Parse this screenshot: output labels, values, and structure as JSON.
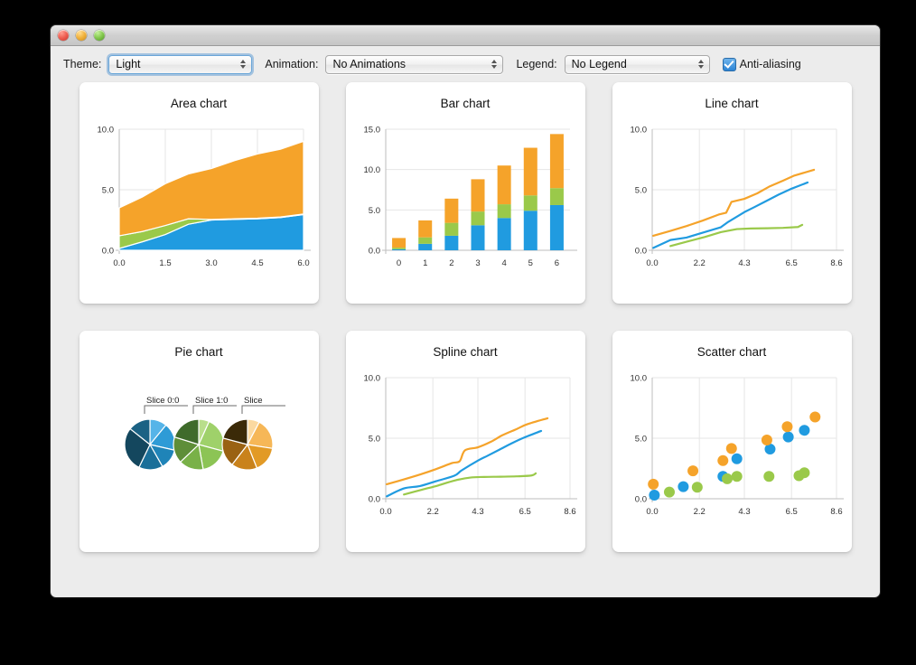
{
  "window": {
    "title": "",
    "controls": [
      "close-button",
      "minimize-button",
      "zoom-button"
    ]
  },
  "toolbar": {
    "theme_label": "Theme:",
    "theme_value": "Light",
    "animation_label": "Animation:",
    "animation_value": "No Animations",
    "legend_label": "Legend:",
    "legend_value": "No Legend",
    "antialiasing_label": "Anti-aliasing",
    "antialiasing_checked": true
  },
  "colors": {
    "series_blue": "#209be0",
    "series_green": "#9ac94a",
    "series_orange": "#f5a32a",
    "background": "#ececec",
    "card": "#ffffff",
    "grid": "#e6e6e6",
    "axis_text": "#303030",
    "accent": "#2b84d6"
  },
  "chart_data": [
    {
      "type": "area",
      "title": "Area chart",
      "xlabel": "",
      "ylabel": "",
      "xlim": [
        0.0,
        6.0
      ],
      "ylim": [
        0.0,
        10.0
      ],
      "xticks": [
        "0.0",
        "1.5",
        "3.0",
        "4.5",
        "6.0"
      ],
      "xtick_values": [
        0.0,
        1.5,
        3.0,
        4.5,
        6.0
      ],
      "yticks": [
        "0.0",
        "5.0",
        "10.0"
      ],
      "ytick_values": [
        0.0,
        5.0,
        10.0
      ],
      "grid": true,
      "legend": "none",
      "stacked": true,
      "x": [
        0.0,
        0.75,
        1.5,
        2.25,
        3.0,
        3.75,
        4.5,
        5.25,
        6.0
      ],
      "series": [
        {
          "name": "series-blue",
          "color": "#209be0",
          "values": [
            0.15,
            0.7,
            1.3,
            2.15,
            2.5,
            2.55,
            2.6,
            2.7,
            2.95
          ]
        },
        {
          "name": "series-green",
          "color": "#9ac94a",
          "values": [
            1.05,
            0.85,
            0.75,
            0.45,
            0.05,
            0.05,
            0.05,
            0.05,
            0.05
          ]
        },
        {
          "name": "series-orange",
          "color": "#f5a32a",
          "values": [
            2.3,
            2.85,
            3.45,
            3.7,
            4.2,
            4.8,
            5.3,
            5.6,
            6.0
          ]
        }
      ]
    },
    {
      "type": "bar",
      "title": "Bar chart",
      "xlabel": "",
      "ylabel": "",
      "ylim": [
        0.0,
        15.0
      ],
      "categories": [
        "0",
        "1",
        "2",
        "3",
        "4",
        "5",
        "6"
      ],
      "yticks": [
        "0.0",
        "5.0",
        "10.0",
        "15.0"
      ],
      "ytick_values": [
        0.0,
        5.0,
        10.0,
        15.0
      ],
      "grid": true,
      "legend": "none",
      "stacked": true,
      "series": [
        {
          "name": "series-blue",
          "color": "#209be0",
          "values": [
            0.12,
            0.8,
            1.8,
            3.1,
            4.0,
            4.9,
            5.6
          ]
        },
        {
          "name": "series-green",
          "color": "#9ac94a",
          "values": [
            0.2,
            0.8,
            1.6,
            1.7,
            1.7,
            1.9,
            2.1
          ]
        },
        {
          "name": "series-orange",
          "color": "#f5a32a",
          "values": [
            1.2,
            2.1,
            3.0,
            4.0,
            4.8,
            5.9,
            6.7
          ]
        }
      ]
    },
    {
      "type": "line",
      "title": "Line chart",
      "xlabel": "",
      "ylabel": "",
      "xlim": [
        0.0,
        8.6
      ],
      "ylim": [
        0.0,
        10.0
      ],
      "xticks": [
        "0.0",
        "2.2",
        "4.3",
        "6.5",
        "8.6"
      ],
      "xtick_values": [
        0.0,
        2.2,
        4.3,
        6.5,
        8.6
      ],
      "yticks": [
        "0.0",
        "5.0",
        "10.0"
      ],
      "ytick_values": [
        0.0,
        5.0,
        10.0
      ],
      "grid": true,
      "legend": "none",
      "smooth": false,
      "series": [
        {
          "name": "series-blue",
          "color": "#209be0",
          "points": [
            [
              0.05,
              0.2
            ],
            [
              0.85,
              0.85
            ],
            [
              1.6,
              1.05
            ],
            [
              2.35,
              1.45
            ],
            [
              3.2,
              1.9
            ],
            [
              3.55,
              2.35
            ],
            [
              4.3,
              3.15
            ],
            [
              4.75,
              3.55
            ],
            [
              5.3,
              4.05
            ],
            [
              5.9,
              4.6
            ],
            [
              6.45,
              5.05
            ],
            [
              7.25,
              5.6
            ]
          ]
        },
        {
          "name": "series-green",
          "color": "#9ac94a",
          "points": [
            [
              0.85,
              0.35
            ],
            [
              1.7,
              0.75
            ],
            [
              2.45,
              1.1
            ],
            [
              3.2,
              1.5
            ],
            [
              3.95,
              1.75
            ],
            [
              4.6,
              1.8
            ],
            [
              5.35,
              1.82
            ],
            [
              6.1,
              1.85
            ],
            [
              6.8,
              1.92
            ],
            [
              7.0,
              2.1
            ]
          ]
        },
        {
          "name": "series-orange",
          "color": "#f5a32a",
          "points": [
            [
              0.05,
              1.2
            ],
            [
              0.85,
              1.6
            ],
            [
              1.6,
              2.0
            ],
            [
              2.35,
              2.45
            ],
            [
              3.1,
              2.95
            ],
            [
              3.45,
              3.1
            ],
            [
              3.7,
              4.0
            ],
            [
              4.3,
              4.25
            ],
            [
              4.9,
              4.7
            ],
            [
              5.45,
              5.25
            ],
            [
              6.1,
              5.75
            ],
            [
              6.6,
              6.15
            ],
            [
              7.55,
              6.65
            ]
          ]
        }
      ]
    },
    {
      "type": "pie",
      "title": "Pie chart",
      "legend": "none",
      "annotations": [
        "Slice 0:0",
        "Slice 1:0",
        "Slice"
      ],
      "pies": [
        {
          "name": "pie-blue",
          "label": "Slice 0:0",
          "slices": [
            1,
            1.6,
            1.2,
            1.4,
            2.6,
            1.3
          ],
          "colors": [
            "#56b4e8",
            "#2e9bd6",
            "#1f84b8",
            "#1a6f99",
            "#14475e",
            "#1b6284"
          ]
        },
        {
          "name": "pie-green",
          "label": "Slice 1:0",
          "slices": [
            0.6,
            2.0,
            1.6,
            1.4,
            1.5,
            1.8
          ],
          "colors": [
            "#b9de8b",
            "#9fd16a",
            "#8cc455",
            "#79b148",
            "#5e8e38",
            "#3f6b2b"
          ]
        },
        {
          "name": "pie-orange",
          "label": "Slice",
          "slices": [
            0.7,
            1.8,
            1.5,
            1.5,
            1.7,
            1.9
          ],
          "colors": [
            "#fbd9a0",
            "#f6b757",
            "#e29a26",
            "#c9821b",
            "#9a6213",
            "#3b2a08"
          ]
        }
      ]
    },
    {
      "type": "spline",
      "title": "Spline chart",
      "xlabel": "",
      "ylabel": "",
      "xlim": [
        0.0,
        8.6
      ],
      "ylim": [
        0.0,
        10.0
      ],
      "xticks": [
        "0.0",
        "2.2",
        "4.3",
        "6.5",
        "8.6"
      ],
      "xtick_values": [
        0.0,
        2.2,
        4.3,
        6.5,
        8.6
      ],
      "yticks": [
        "0.0",
        "5.0",
        "10.0"
      ],
      "ytick_values": [
        0.0,
        5.0,
        10.0
      ],
      "grid": true,
      "legend": "none",
      "smooth": true,
      "series": [
        {
          "name": "series-blue",
          "color": "#209be0",
          "points": [
            [
              0.05,
              0.2
            ],
            [
              0.85,
              0.85
            ],
            [
              1.6,
              1.05
            ],
            [
              2.35,
              1.45
            ],
            [
              3.2,
              1.9
            ],
            [
              3.55,
              2.35
            ],
            [
              4.3,
              3.15
            ],
            [
              4.75,
              3.55
            ],
            [
              5.3,
              4.05
            ],
            [
              5.9,
              4.6
            ],
            [
              6.45,
              5.05
            ],
            [
              7.25,
              5.6
            ]
          ]
        },
        {
          "name": "series-green",
          "color": "#9ac94a",
          "points": [
            [
              0.85,
              0.35
            ],
            [
              1.7,
              0.75
            ],
            [
              2.45,
              1.1
            ],
            [
              3.2,
              1.5
            ],
            [
              3.95,
              1.75
            ],
            [
              4.6,
              1.8
            ],
            [
              5.35,
              1.82
            ],
            [
              6.1,
              1.85
            ],
            [
              6.8,
              1.92
            ],
            [
              7.0,
              2.1
            ]
          ]
        },
        {
          "name": "series-orange",
          "color": "#f5a32a",
          "points": [
            [
              0.05,
              1.2
            ],
            [
              0.85,
              1.6
            ],
            [
              1.6,
              2.0
            ],
            [
              2.35,
              2.45
            ],
            [
              3.1,
              2.95
            ],
            [
              3.45,
              3.1
            ],
            [
              3.7,
              4.0
            ],
            [
              4.3,
              4.25
            ],
            [
              4.9,
              4.7
            ],
            [
              5.45,
              5.25
            ],
            [
              6.1,
              5.75
            ],
            [
              6.6,
              6.15
            ],
            [
              7.55,
              6.65
            ]
          ]
        }
      ]
    },
    {
      "type": "scatter",
      "title": "Scatter chart",
      "xlabel": "",
      "ylabel": "",
      "xlim": [
        0.0,
        8.6
      ],
      "ylim": [
        0.0,
        10.0
      ],
      "xticks": [
        "0.0",
        "2.2",
        "4.3",
        "6.5",
        "8.6"
      ],
      "xtick_values": [
        0.0,
        2.2,
        4.3,
        6.5,
        8.6
      ],
      "yticks": [
        "0.0",
        "5.0",
        "10.0"
      ],
      "ytick_values": [
        0.0,
        5.0,
        10.0
      ],
      "grid": true,
      "legend": "none",
      "series": [
        {
          "name": "series-blue",
          "color": "#209be0",
          "points": [
            [
              0.1,
              0.3
            ],
            [
              1.45,
              1.0
            ],
            [
              3.3,
              1.85
            ],
            [
              3.95,
              3.3
            ],
            [
              5.5,
              4.1
            ],
            [
              6.35,
              5.1
            ],
            [
              7.1,
              5.65
            ]
          ]
        },
        {
          "name": "series-green",
          "color": "#9ac94a",
          "points": [
            [
              0.8,
              0.55
            ],
            [
              2.1,
              0.95
            ],
            [
              3.5,
              1.65
            ],
            [
              3.95,
              1.85
            ],
            [
              5.45,
              1.85
            ],
            [
              6.85,
              1.9
            ],
            [
              7.1,
              2.15
            ]
          ]
        },
        {
          "name": "series-orange",
          "color": "#f5a32a",
          "points": [
            [
              0.05,
              1.2
            ],
            [
              1.9,
              2.3
            ],
            [
              3.3,
              3.15
            ],
            [
              3.7,
              4.15
            ],
            [
              5.35,
              4.85
            ],
            [
              6.3,
              5.95
            ],
            [
              7.6,
              6.75
            ]
          ]
        }
      ]
    }
  ]
}
